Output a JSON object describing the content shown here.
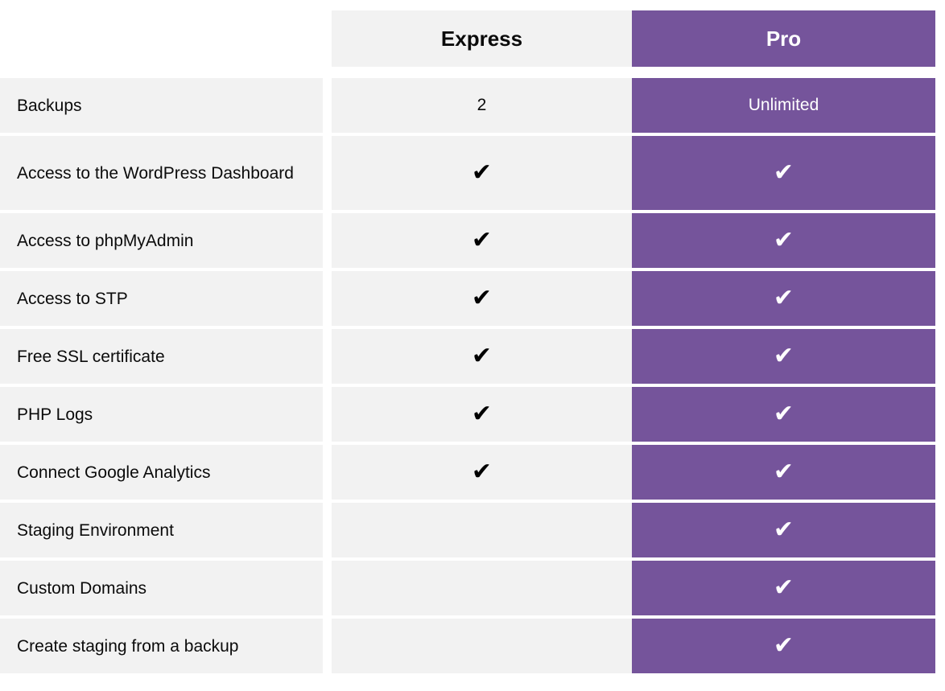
{
  "table": {
    "columns": [
      {
        "key": "feature",
        "label": ""
      },
      {
        "key": "express",
        "label": "Express"
      },
      {
        "key": "pro",
        "label": "Pro"
      }
    ],
    "colors": {
      "pro_accent": "#75549b",
      "cell_background": "#f2f2f2",
      "page_background": "#ffffff",
      "text": "#0b0b0b",
      "pro_text": "#ffffff"
    },
    "check_glyph": "✔",
    "rows": [
      {
        "feature": "Backups",
        "express": "2",
        "pro": "Unlimited",
        "express_check": false,
        "pro_check": false
      },
      {
        "feature": "Access to the WordPress Dashboard",
        "express": "✔",
        "pro": "✔",
        "express_check": true,
        "pro_check": true
      },
      {
        "feature": "Access to phpMyAdmin",
        "express": "✔",
        "pro": "✔",
        "express_check": true,
        "pro_check": true
      },
      {
        "feature": "Access to STP",
        "express": "✔",
        "pro": "✔",
        "express_check": true,
        "pro_check": true
      },
      {
        "feature": "Free SSL certificate",
        "express": "✔",
        "pro": "✔",
        "express_check": true,
        "pro_check": true
      },
      {
        "feature": "PHP Logs",
        "express": "✔",
        "pro": "✔",
        "express_check": true,
        "pro_check": true
      },
      {
        "feature": "Connect Google Analytics",
        "express": "✔",
        "pro": "✔",
        "express_check": true,
        "pro_check": true
      },
      {
        "feature": "Staging Environment",
        "express": "",
        "pro": "✔",
        "express_check": false,
        "pro_check": true
      },
      {
        "feature": "Custom Domains",
        "express": "",
        "pro": "✔",
        "express_check": false,
        "pro_check": true
      },
      {
        "feature": "Create staging from a backup",
        "express": "",
        "pro": "✔",
        "express_check": false,
        "pro_check": true
      }
    ]
  }
}
